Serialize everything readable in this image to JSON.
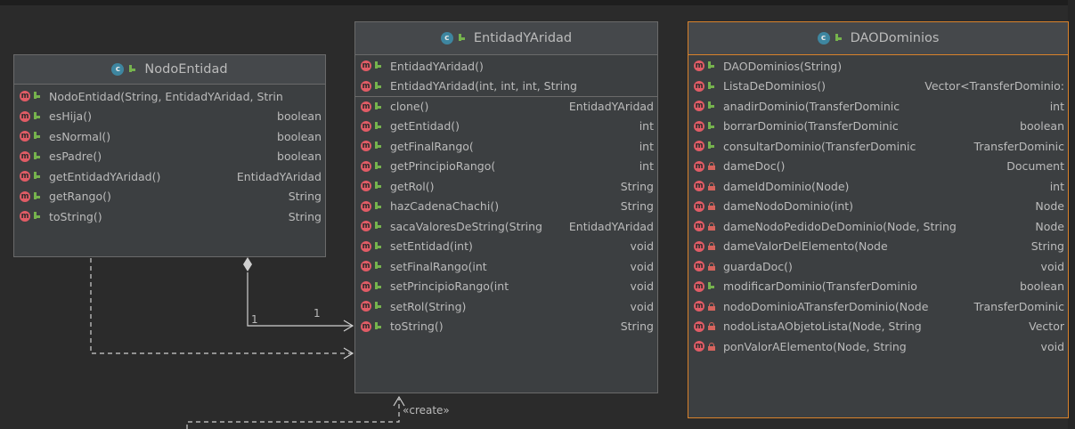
{
  "classes": {
    "nodo_entidad": {
      "title": "NodoEntidad",
      "methods": [
        {
          "name": "NodoEntidad(String, EntidadYAridad, Strin",
          "type": ""
        },
        {
          "name": "esHija()",
          "type": "boolean"
        },
        {
          "name": "esNormal()",
          "type": "boolean"
        },
        {
          "name": "esPadre()",
          "type": "boolean"
        },
        {
          "name": "getEntidadYAridad()",
          "type": "EntidadYAridad"
        },
        {
          "name": "getRango()",
          "type": "String"
        },
        {
          "name": "toString()",
          "type": "String"
        }
      ]
    },
    "entidad_y_aridad": {
      "title": "EntidadYAridad",
      "methods": [
        {
          "name": "EntidadYAridad()",
          "type": ""
        },
        {
          "name": "EntidadYAridad(int, int, int, String",
          "type": ""
        },
        {
          "name": "clone()",
          "type": "EntidadYAridad"
        },
        {
          "name": "getEntidad()",
          "type": "int"
        },
        {
          "name": "getFinalRango(",
          "type": "int"
        },
        {
          "name": "getPrincipioRango(",
          "type": "int"
        },
        {
          "name": "getRol()",
          "type": "String"
        },
        {
          "name": "hazCadenaChachi()",
          "type": "String"
        },
        {
          "name": "sacaValoresDeString(String",
          "type": "EntidadYAridad"
        },
        {
          "name": "setEntidad(int)",
          "type": "void"
        },
        {
          "name": "setFinalRango(int",
          "type": "void"
        },
        {
          "name": "setPrincipioRango(int",
          "type": "void"
        },
        {
          "name": "setRol(String)",
          "type": "void"
        },
        {
          "name": "toString()",
          "type": "String"
        }
      ]
    },
    "dao_dominios": {
      "title": "DAODominios",
      "methods": [
        {
          "name": "DAODominios(String)",
          "type": "",
          "access": "public"
        },
        {
          "name": "ListaDeDominios()",
          "type": "Vector<TransferDominio:",
          "access": "public"
        },
        {
          "name": "anadirDominio(TransferDominic",
          "type": "int",
          "access": "public"
        },
        {
          "name": "borrarDominio(TransferDominic",
          "type": "boolean",
          "access": "public"
        },
        {
          "name": "consultarDominio(TransferDominic",
          "type": "TransferDominic",
          "access": "public"
        },
        {
          "name": "dameDoc()",
          "type": "Document",
          "access": "private"
        },
        {
          "name": "dameIdDominio(Node)",
          "type": "int",
          "access": "private"
        },
        {
          "name": "dameNodoDominio(int)",
          "type": "Node",
          "access": "private"
        },
        {
          "name": "dameNodoPedidoDeDominio(Node, String",
          "type": "Node",
          "access": "private"
        },
        {
          "name": "dameValorDelElemento(Node",
          "type": "String",
          "access": "private"
        },
        {
          "name": "guardaDoc()",
          "type": "void",
          "access": "private"
        },
        {
          "name": "modificarDominio(TransferDominio",
          "type": "boolean",
          "access": "public"
        },
        {
          "name": "nodoDominioATransferDominio(Node",
          "type": "TransferDominic",
          "access": "private"
        },
        {
          "name": "nodoListaAObjetoLista(Node, String",
          "type": "Vector",
          "access": "private"
        },
        {
          "name": "ponValorAElemento(Node, String",
          "type": "void",
          "access": "private"
        }
      ]
    }
  },
  "labels": {
    "multiplicity_left": "1",
    "multiplicity_right": "1",
    "create_stereotype": "«create»"
  },
  "icons": {
    "class": "class-icon",
    "method": "method-icon",
    "public": "public-access-icon",
    "private": "private-access-icon"
  },
  "colors": {
    "background": "#2b2b2b",
    "box": "#3c3f41",
    "header": "#45484b",
    "selected_border": "#d9822b",
    "method_icon": "#e15c66",
    "class_icon": "#3e86a0",
    "public_icon": "#76b34d",
    "private_icon": "#d5645d"
  }
}
